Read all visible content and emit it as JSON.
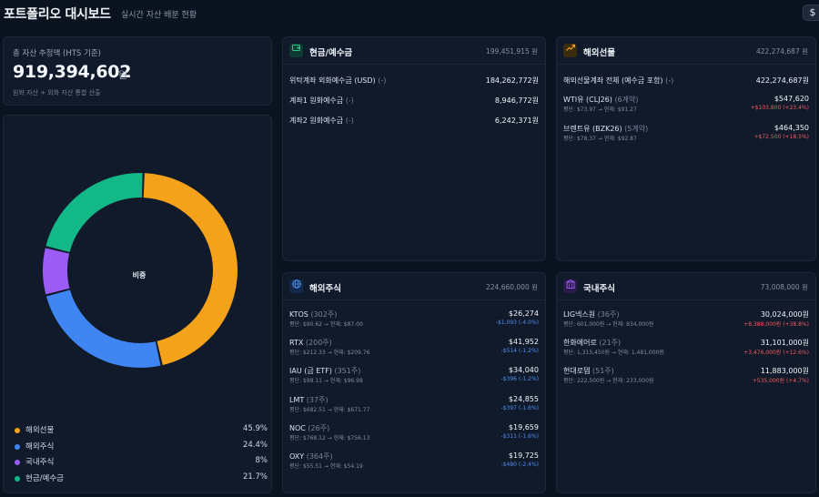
{
  "header": {
    "title": "포트폴리오 대시보드",
    "subtitle": "실시간 자산 배분 현황",
    "currency_icon": "$"
  },
  "summary": {
    "label": "총 자산 추정액 (HTS 기준)",
    "value": "919,394,602",
    "unit": "원",
    "note": "원화 자산 + 외화 자산 통합 산출"
  },
  "allocation": {
    "center_label": "비중",
    "items": [
      {
        "name": "해외선물",
        "pct_label": "45.9%",
        "pct": 45.9,
        "color": "#f5a21b"
      },
      {
        "name": "해외주식",
        "pct_label": "24.4%",
        "pct": 24.4,
        "color": "#3f86f2"
      },
      {
        "name": "국내주식",
        "pct_label": "8%",
        "pct": 8.0,
        "color": "#9b5cf5"
      },
      {
        "name": "현금/예수금",
        "pct_label": "21.7%",
        "pct": 21.7,
        "color": "#12b886"
      }
    ]
  },
  "cash": {
    "icon": "wallet-icon",
    "title": "현금/예수금",
    "total": "199,451,915 원",
    "rows": [
      {
        "name": "위탁계좌 외화예수금 (USD)",
        "tag": "(-)",
        "value": "184,262,772원"
      },
      {
        "name": "계좌1 원화예수금",
        "tag": "(-)",
        "value": "8,946,772원"
      },
      {
        "name": "계좌2 원화예수금",
        "tag": "(-)",
        "value": "6,242,371원"
      }
    ]
  },
  "futures": {
    "icon": "trend-up-icon",
    "title": "해외선물",
    "total": "422,274,687 원",
    "account": {
      "name": "해외선물계좌 전체 (예수금 포함)",
      "tag": "(-)",
      "value": "422,274,687원"
    },
    "rows": [
      {
        "name": "WTI유 (CLJ26)",
        "tag": "(6계약)",
        "value": "$547,620",
        "sub": "평단: $73.97 → 현재: $91.27",
        "chg": "+$103,800 (+23.4%)",
        "dir": "up"
      },
      {
        "name": "브렌트유 (BZK26)",
        "tag": "(5계약)",
        "value": "$464,350",
        "sub": "평단: $78.37 → 현재: $92.87",
        "chg": "+$72,500 (+18.5%)",
        "dir": "up"
      }
    ]
  },
  "foreign_stocks": {
    "icon": "globe-icon",
    "title": "해외주식",
    "total": "224,660,000 원",
    "rows": [
      {
        "name": "KTOS",
        "tag": "(302주)",
        "value": "$26,274",
        "sub": "평단: $90.62 → 현재: $87.00",
        "chg": "-$1,093 (-4.0%)",
        "dir": "down"
      },
      {
        "name": "RTX",
        "tag": "(200주)",
        "value": "$41,952",
        "sub": "평단: $212.33 → 현재: $209.76",
        "chg": "-$514 (-1.2%)",
        "dir": "down"
      },
      {
        "name": "IAU (금 ETF)",
        "tag": "(351주)",
        "value": "$34,040",
        "sub": "평단: $98.11 → 현재: $96.98",
        "chg": "-$396 (-1.2%)",
        "dir": "down"
      },
      {
        "name": "LMT",
        "tag": "(37주)",
        "value": "$24,855",
        "sub": "평단: $682.51 → 현재: $671.77",
        "chg": "-$397 (-1.6%)",
        "dir": "down"
      },
      {
        "name": "NOC",
        "tag": "(26주)",
        "value": "$19,659",
        "sub": "평단: $768.12 → 현재: $756.13",
        "chg": "-$311 (-1.6%)",
        "dir": "down"
      },
      {
        "name": "OXY",
        "tag": "(364주)",
        "value": "$19,725",
        "sub": "평단: $55.51 → 현재: $54.19",
        "chg": "-$480 (-2.4%)",
        "dir": "down"
      }
    ]
  },
  "domestic_stocks": {
    "icon": "building-icon",
    "title": "국내주식",
    "total": "73,008,000 원",
    "rows": [
      {
        "name": "LIG넥스원",
        "tag": "(36주)",
        "value": "30,024,000원",
        "sub": "평단: 601,000원 → 현재: 834,000원",
        "chg": "+8,388,000원 (+38.8%)",
        "dir": "up"
      },
      {
        "name": "한화에어로",
        "tag": "(21주)",
        "value": "31,101,000원",
        "sub": "평단: 1,315,450원 → 현재: 1,481,000원",
        "chg": "+3,476,000원 (+12.6%)",
        "dir": "up"
      },
      {
        "name": "현대로템",
        "tag": "(51주)",
        "value": "11,883,000원",
        "sub": "평단: 222,500원 → 현재: 233,000원",
        "chg": "+535,000원 (+4.7%)",
        "dir": "up"
      }
    ]
  }
}
